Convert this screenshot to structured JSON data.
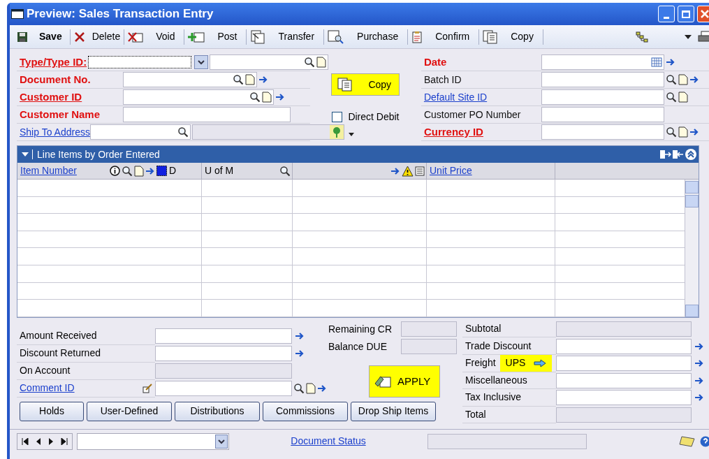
{
  "window": {
    "title": "Preview: Sales Transaction Entry"
  },
  "toolbar": [
    {
      "kind": "save",
      "label": "Save"
    },
    {
      "kind": "delete",
      "label": "Delete"
    },
    {
      "kind": "void",
      "label": "Void"
    },
    {
      "kind": "post",
      "label": "Post"
    },
    {
      "kind": "transfer",
      "label": "Transfer"
    },
    {
      "kind": "purchase",
      "label": "Purchase"
    },
    {
      "kind": "confirm",
      "label": "Confirm"
    },
    {
      "kind": "copy",
      "label": "Copy"
    }
  ],
  "header": {
    "left": [
      {
        "label": "Type/Type ID:",
        "required": true,
        "link": true,
        "kind": "type"
      },
      {
        "label": "Document No.",
        "required": true,
        "link": false,
        "kind": "document"
      },
      {
        "label": "Customer ID",
        "required": true,
        "link": true,
        "kind": "customer"
      },
      {
        "label": "Customer Name",
        "required": true,
        "link": false,
        "kind": "name"
      },
      {
        "label": "Ship To Address",
        "required": false,
        "link": true,
        "kind": "ship"
      }
    ],
    "copy_button": "Copy",
    "direct_debit": {
      "label": "Direct Debit",
      "checked": false
    },
    "right": [
      {
        "label": "Date",
        "required": true,
        "link": false,
        "kind": "date"
      },
      {
        "label": "Batch ID",
        "required": false,
        "link": false,
        "kind": "full"
      },
      {
        "label": "Default Site ID",
        "required": false,
        "link": true,
        "kind": "lookup"
      },
      {
        "label": "Customer PO Number",
        "required": false,
        "link": false,
        "kind": "plain"
      },
      {
        "label": "Currency ID",
        "required": true,
        "link": true,
        "kind": "full"
      }
    ]
  },
  "grid": {
    "title": "Line Items by Order Entered",
    "columns": {
      "item": "Item Number",
      "d": "D",
      "uom": "U of M",
      "price": "Unit Price"
    }
  },
  "totals": {
    "left": [
      {
        "label": "Amount Received",
        "link": false,
        "kind": "arrow"
      },
      {
        "label": "Discount Returned",
        "link": false,
        "kind": "arrow"
      },
      {
        "label": "On Account",
        "link": false,
        "kind": "readonly"
      },
      {
        "label": "Comment ID",
        "link": true,
        "kind": "comment"
      }
    ],
    "middle": [
      {
        "label": "Remaining CR"
      },
      {
        "label": "Balance DUE"
      }
    ],
    "apply": "APPLY",
    "right": [
      {
        "label": "Subtotal",
        "kind": "readonly"
      },
      {
        "label": "Trade Discount",
        "kind": "arrow"
      },
      {
        "label": "Freight",
        "kind": "freight",
        "carrier": "UPS"
      },
      {
        "label": "Miscellaneous",
        "kind": "arrow"
      },
      {
        "label": "Tax Inclusive",
        "kind": "arrow"
      },
      {
        "label": "Total",
        "kind": "readonly"
      }
    ]
  },
  "buttons": [
    "Holds",
    "User-Defined",
    "Distributions",
    "Commissions",
    "Drop Ship Items"
  ],
  "status_bar": {
    "link": "Document Status"
  }
}
